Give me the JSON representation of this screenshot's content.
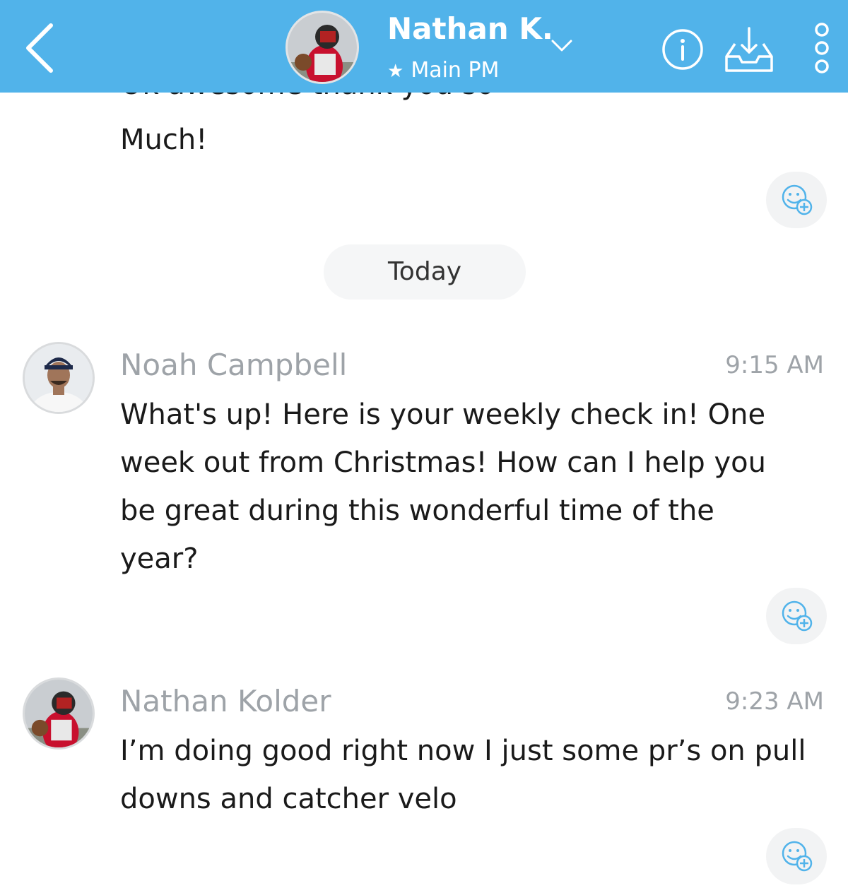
{
  "header": {
    "contact_name": "Nathan K.",
    "subtitle": "Main PM",
    "subtitle_icon": "star-icon",
    "background_color": "#51b3ea"
  },
  "icons": {
    "back": "chevron-left-icon",
    "name_menu": "chevron-down-icon",
    "info": "info-icon",
    "inbox": "inbox-download-icon",
    "more": "more-vertical-icon",
    "reaction": "add-reaction-icon"
  },
  "previous_message": {
    "partial_line": "Ok awesome thank you so",
    "text": "Much!"
  },
  "divider": {
    "label": "Today"
  },
  "messages": [
    {
      "sender": "Noah Campbell",
      "time": "9:15 AM",
      "lines": [
        "What's up! Here is your weekly check in! One",
        "week out from Christmas! How can I help you",
        "be great during this wonderful time of the",
        "year?"
      ]
    },
    {
      "sender": "Nathan Kolder",
      "time": "9:23 AM",
      "lines": [
        "I’m doing good right now I just some pr’s on pull",
        "downs and catcher velo"
      ]
    }
  ]
}
